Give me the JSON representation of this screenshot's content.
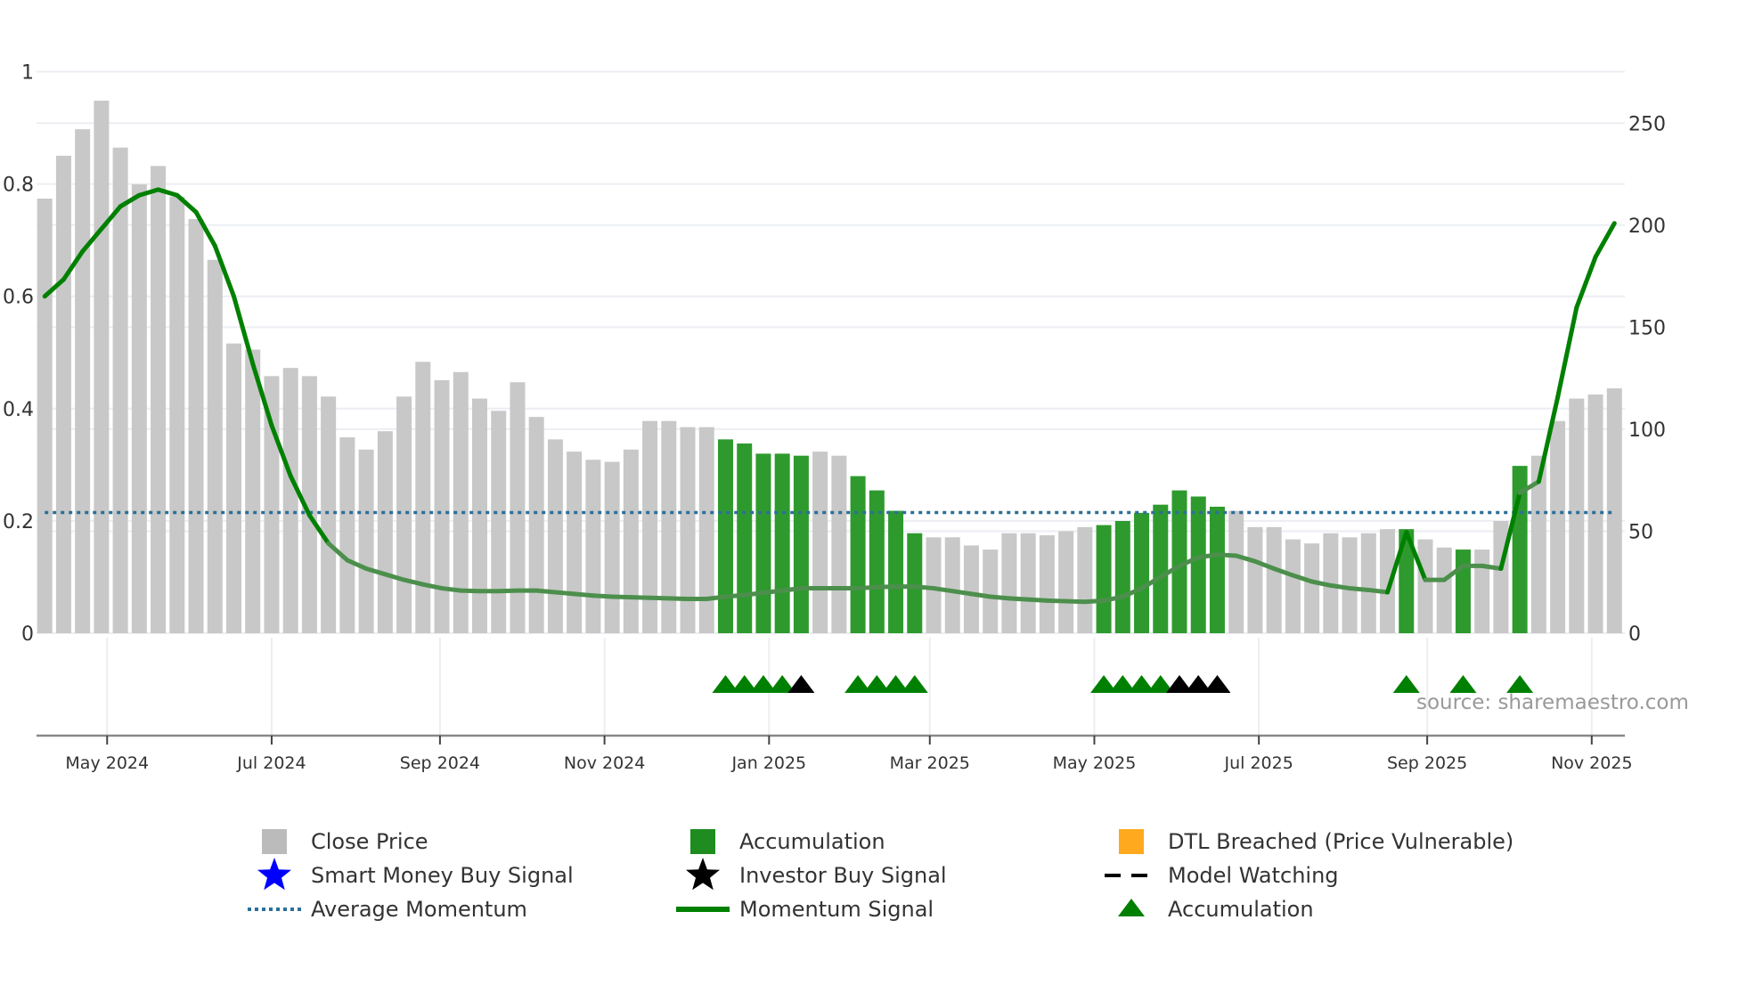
{
  "chart_data": {
    "type": "bar+line",
    "title": "",
    "left_axis": {
      "ticks": [
        "0",
        "0.2",
        "0.4",
        "0.6",
        "0.8",
        "1"
      ],
      "ylim": [
        0,
        1
      ]
    },
    "right_axis": {
      "ticks": [
        "0",
        "50",
        "100",
        "150",
        "200",
        "250"
      ],
      "ylim": [
        0,
        275
      ]
    },
    "x_ticks": [
      "May 2024",
      "Jul 2024",
      "Sep 2024",
      "Nov 2024",
      "Jan 2025",
      "Mar 2025",
      "May 2025",
      "Jul 2025",
      "Sep 2025",
      "Nov 2025"
    ],
    "x_tick_bar_index": [
      4.3,
      13.0,
      21.9,
      30.6,
      39.3,
      47.8,
      56.5,
      65.2,
      74.1,
      82.8
    ],
    "close_price": [
      213,
      234,
      247,
      261,
      238,
      220,
      229,
      214,
      203,
      183,
      142,
      139,
      126,
      130,
      126,
      116,
      96,
      90,
      99,
      116,
      133,
      124,
      128,
      115,
      109,
      123,
      106,
      95,
      89,
      85,
      84,
      90,
      104,
      104,
      101,
      101,
      95,
      93,
      88,
      88,
      87,
      89,
      87,
      77,
      70,
      60,
      49,
      47,
      47,
      43,
      41,
      49,
      49,
      48,
      50,
      52,
      53,
      55,
      59,
      63,
      70,
      67,
      62,
      60,
      52,
      52,
      46,
      44,
      49,
      47,
      49,
      51,
      51,
      46,
      42,
      41,
      41,
      55,
      82,
      87,
      104,
      115,
      117,
      120
    ],
    "accumulation_bars": [
      37,
      38,
      39,
      40,
      41,
      44,
      45,
      46,
      47,
      57,
      58,
      59,
      60,
      61,
      62,
      63,
      73,
      76,
      79
    ],
    "momentum_signal": [
      0.6,
      0.63,
      0.68,
      0.72,
      0.76,
      0.78,
      0.79,
      0.78,
      0.75,
      0.69,
      0.6,
      0.48,
      0.37,
      0.28,
      0.21,
      0.16,
      0.13,
      0.115,
      0.105,
      0.095,
      0.087,
      0.08,
      0.076,
      0.075,
      0.075,
      0.076,
      0.076,
      0.073,
      0.07,
      0.067,
      0.065,
      0.064,
      0.063,
      0.062,
      0.061,
      0.061,
      0.065,
      0.068,
      0.072,
      0.076,
      0.08,
      0.08,
      0.08,
      0.08,
      0.082,
      0.083,
      0.083,
      0.08,
      0.075,
      0.07,
      0.065,
      0.062,
      0.06,
      0.058,
      0.057,
      0.056,
      0.058,
      0.065,
      0.08,
      0.1,
      0.12,
      0.135,
      0.14,
      0.138,
      0.128,
      0.115,
      0.103,
      0.092,
      0.085,
      0.08,
      0.077,
      0.073,
      0.18,
      0.095,
      0.095,
      0.12,
      0.12,
      0.115,
      0.25,
      0.27,
      0.42,
      0.58,
      0.67,
      0.73
    ],
    "average_momentum": 0.215,
    "accumulation_markers": [
      37,
      38,
      39,
      40,
      44,
      45,
      46,
      47,
      57,
      58,
      59,
      60,
      73,
      76,
      79
    ],
    "investor_buy_markers": [
      41,
      61,
      62,
      63
    ],
    "legend": [
      {
        "label": "Close Price",
        "color": "#bbbbbb",
        "kind": "bar"
      },
      {
        "label": "Accumulation",
        "color": "#1e8c1e",
        "kind": "bar"
      },
      {
        "label": "DTL Breached (Price Vulnerable)",
        "color": "#ffa91e",
        "kind": "bar"
      },
      {
        "label": "Smart Money Buy Signal",
        "color": "#0000ff",
        "kind": "star"
      },
      {
        "label": "Investor Buy Signal",
        "color": "#000000",
        "kind": "star"
      },
      {
        "label": "Model Watching",
        "color": "#000000",
        "kind": "dash"
      },
      {
        "label": "Average Momentum",
        "color": "#2c6f9a",
        "kind": "dot"
      },
      {
        "label": "Momentum Signal",
        "color": "#008000",
        "kind": "line"
      },
      {
        "label": "Accumulation",
        "color": "#008000",
        "kind": "triangle"
      }
    ],
    "legend_placement": "bottom",
    "grid": true
  },
  "source": "source: sharemaestro.com",
  "colors": {
    "price": "#c8c8c8",
    "accum": "#2e9a2e",
    "momentum": "#008000",
    "momentum_light": "#4c8f4c",
    "avg": "#2c6f9a",
    "grid": "#eceef3",
    "axis": "#888888"
  }
}
